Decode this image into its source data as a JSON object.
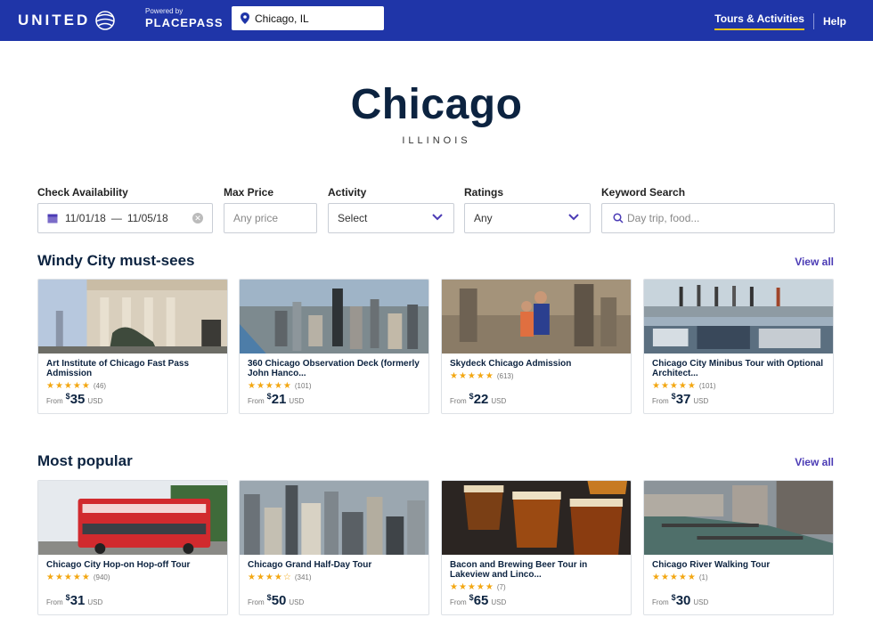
{
  "nav": {
    "brand": "UNITED",
    "powered_by": "Powered by",
    "partner": "PLACEPASS",
    "location_value": "Chicago, IL",
    "tours_link": "Tours & Activities",
    "help_link": "Help",
    "bar_color": "#1f35a8",
    "active_underline_color": "#f5c518"
  },
  "hero": {
    "city": "Chicago",
    "state": "ILLINOIS"
  },
  "filters": {
    "check_availability": {
      "label": "Check Availability",
      "start": "11/01/18",
      "separator": "—",
      "end": "11/05/18"
    },
    "max_price": {
      "label": "Max Price",
      "placeholder": "Any price"
    },
    "activity": {
      "label": "Activity",
      "value": "Select"
    },
    "ratings": {
      "label": "Ratings",
      "value": "Any"
    },
    "keyword": {
      "label": "Keyword Search",
      "placeholder": "Day trip, food..."
    }
  },
  "sections": [
    {
      "title": "Windy City must-sees",
      "view_all": "View all",
      "cards": [
        {
          "title": "Art Institute of Chicago Fast Pass Admission",
          "stars": "★★★★★",
          "rating": 4.5,
          "count": "(46)",
          "from": "From",
          "currency": "$",
          "price": "35",
          "unit": "USD"
        },
        {
          "title": "360 Chicago Observation Deck (formerly John Hanco...",
          "stars": "★★★★★",
          "rating": 4.5,
          "count": "(101)",
          "from": "From",
          "currency": "$",
          "price": "21",
          "unit": "USD"
        },
        {
          "title": "Skydeck Chicago Admission",
          "stars": "★★★★★",
          "rating": 4.5,
          "count": "(613)",
          "from": "From",
          "currency": "$",
          "price": "22",
          "unit": "USD"
        },
        {
          "title": "Chicago City Minibus Tour with Optional Architect...",
          "stars": "★★★★★",
          "rating": 5,
          "count": "(101)",
          "from": "From",
          "currency": "$",
          "price": "37",
          "unit": "USD"
        }
      ]
    },
    {
      "title": "Most popular",
      "view_all": "View all",
      "cards": [
        {
          "title": "Chicago City Hop-on Hop-off Tour",
          "stars": "★★★★★",
          "rating": 4.5,
          "count": "(940)",
          "from": "From",
          "currency": "$",
          "price": "31",
          "unit": "USD"
        },
        {
          "title": "Chicago Grand Half-Day Tour",
          "stars": "★★★★☆",
          "rating": 4,
          "count": "(341)",
          "from": "From",
          "currency": "$",
          "price": "50",
          "unit": "USD"
        },
        {
          "title": "Bacon and Brewing Beer Tour in Lakeview and Linco...",
          "stars": "★★★★★",
          "rating": 5,
          "count": "(7)",
          "from": "From",
          "currency": "$",
          "price": "65",
          "unit": "USD"
        },
        {
          "title": "Chicago River Walking Tour",
          "stars": "★★★★★",
          "rating": 5,
          "count": "(1)",
          "from": "From",
          "currency": "$",
          "price": "30",
          "unit": "USD"
        }
      ]
    }
  ]
}
